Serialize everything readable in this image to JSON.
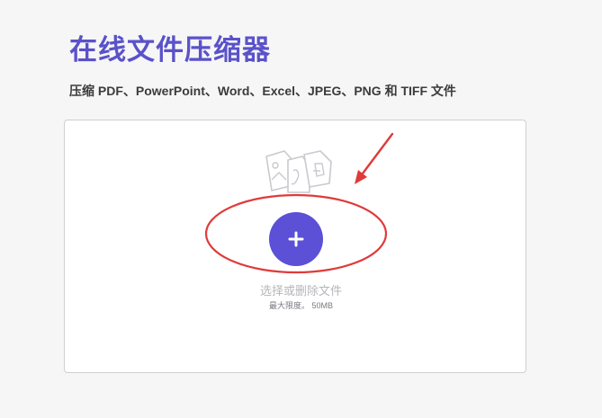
{
  "header": {
    "title": "在线文件压缩器",
    "subtitle": "压缩 PDF、PowerPoint、Word、Excel、JPEG、PNG 和 TIFF 文件"
  },
  "dropzone": {
    "button_icon": "plus-icon",
    "prompt": "选择或删除文件",
    "limit": "最大限度。 50MB",
    "decor_icon": "file-types-icon"
  },
  "annotations": {
    "arrow": "red-arrow",
    "highlight": "red-ellipse"
  },
  "colors": {
    "accent": "#5b50d6",
    "title": "#5a52c9",
    "annotation": "#e03a3a",
    "icon_outline": "#c9c9cf"
  }
}
